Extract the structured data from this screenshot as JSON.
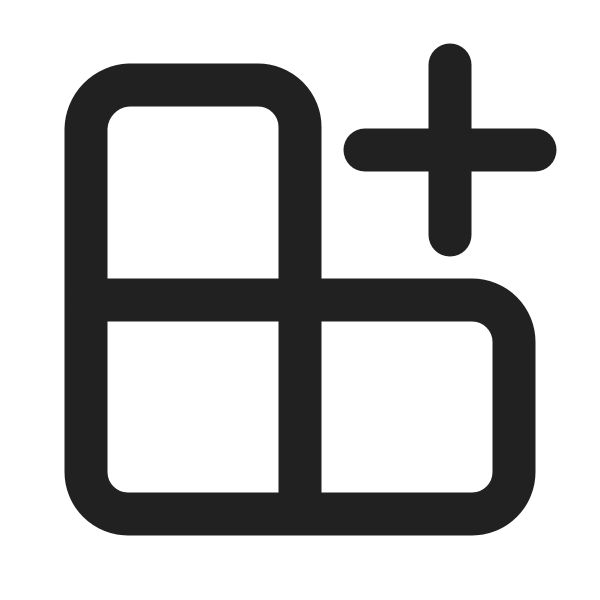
{
  "icon": {
    "name": "apps-add-in-icon",
    "stroke_color": "#212121",
    "background_color": "#ffffff"
  }
}
